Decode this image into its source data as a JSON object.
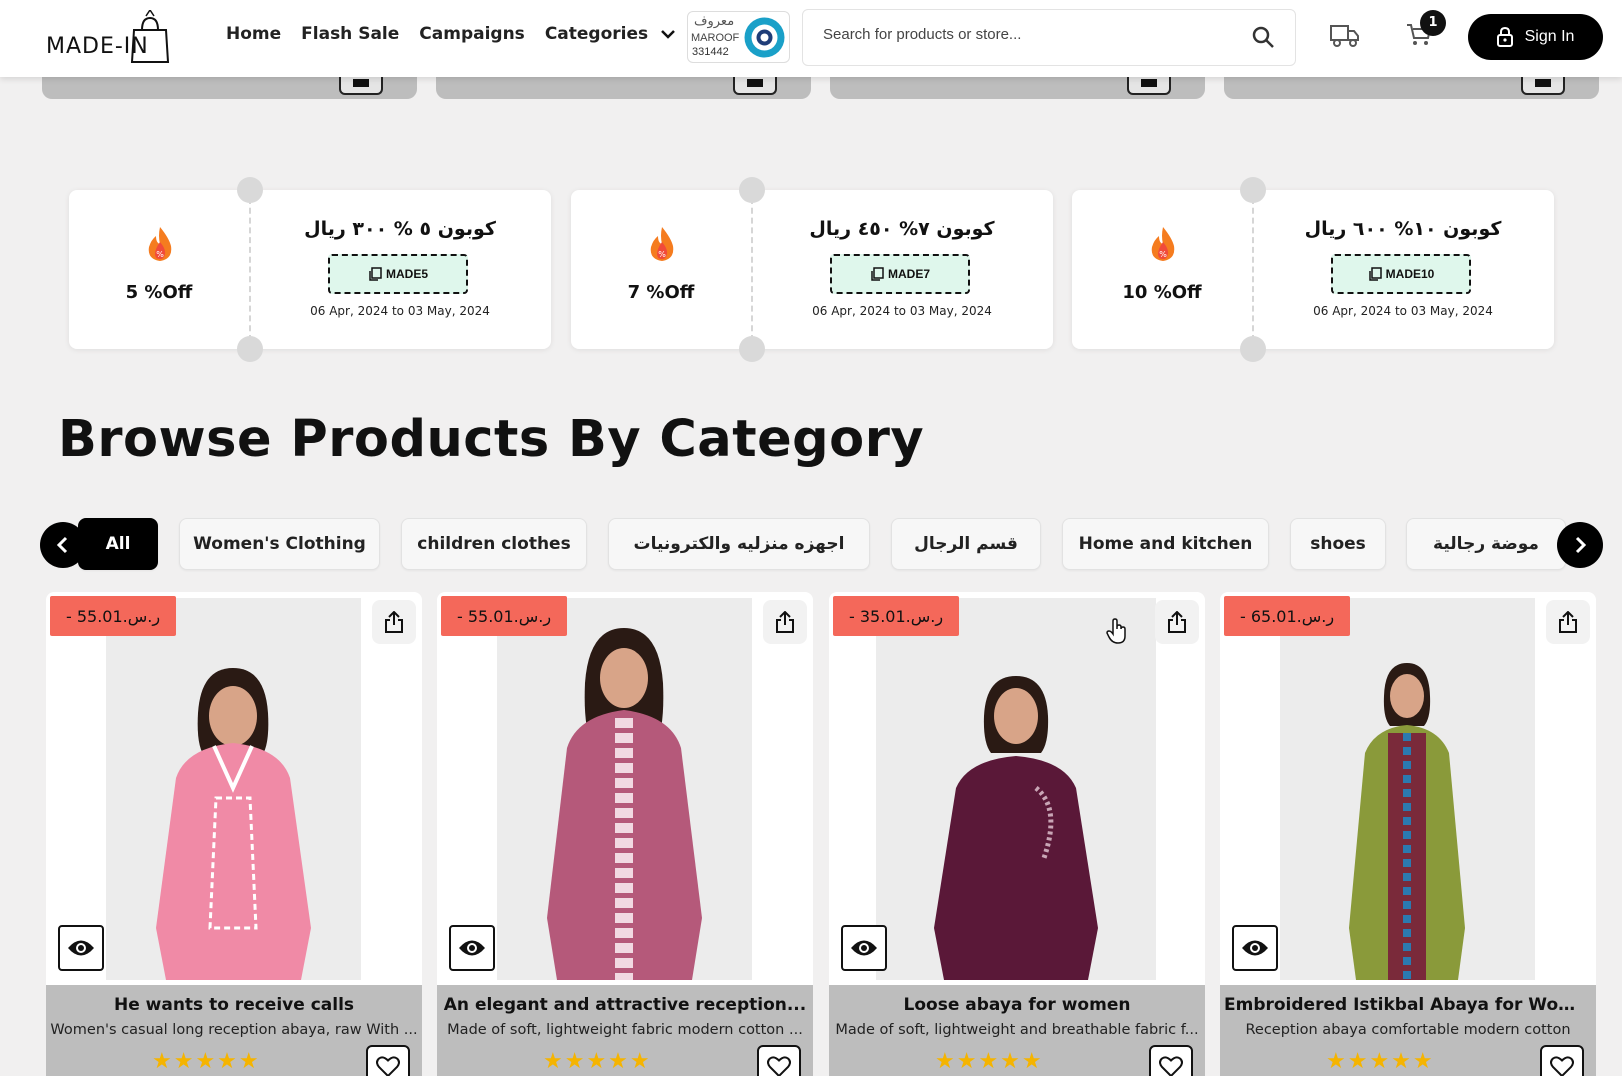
{
  "header": {
    "logo_text": "MADE-IN",
    "nav": [
      "Home",
      "Flash Sale",
      "Campaigns",
      "Categories"
    ],
    "maroof": {
      "arabic": "معروف",
      "english": "MAROOF",
      "number": "331442"
    },
    "search_placeholder": "Search for products or store...",
    "cart_count": "1",
    "signin_label": "Sign In"
  },
  "coupons": [
    {
      "off": "5 %Off",
      "title": "كوبون ٥ % ٣٠٠ ريال",
      "code": "MADE5",
      "dates": "06 Apr, 2024 to 03 May, 2024"
    },
    {
      "off": "7 %Off",
      "title": "كوبون ٧% ٤٥٠ ريال",
      "code": "MADE7",
      "dates": "06 Apr, 2024 to 03 May, 2024"
    },
    {
      "off": "10 %Off",
      "title": "كوبون ١٠% ٦٠٠ ريال",
      "code": "MADE10",
      "dates": "06 Apr, 2024 to 03 May, 2024"
    }
  ],
  "browse_heading": "Browse Products By Category",
  "categories": [
    "All",
    "Women's Clothing",
    "children clothes",
    "اجهزه منزليه والكترونيات",
    "قسم الرجال",
    "Home and kitchen",
    "shoes",
    "موضة رجالية"
  ],
  "products": [
    {
      "price": "ر.س.55.01 -",
      "name": "He wants to receive calls",
      "desc": "Women's casual long reception abaya, raw With ...",
      "rating": 5,
      "color": "#f08aa6"
    },
    {
      "price": "ر.س.55.01 -",
      "name": "An elegant and attractive reception...",
      "desc": "Made of soft, lightweight fabric modern cotton ...",
      "rating": 5,
      "color": "#b5597a"
    },
    {
      "price": "ر.س.35.01 -",
      "name": "Loose abaya for women",
      "desc": "Made of soft, lightweight and breathable fabric f...",
      "rating": 5,
      "color": "#5a1838"
    },
    {
      "price": "ر.س.65.01 -",
      "name": "Embroidered Istikbal Abaya for Women",
      "desc": "Reception abaya comfortable modern cotton",
      "rating": 5,
      "color": "#8a9a3a"
    }
  ]
}
